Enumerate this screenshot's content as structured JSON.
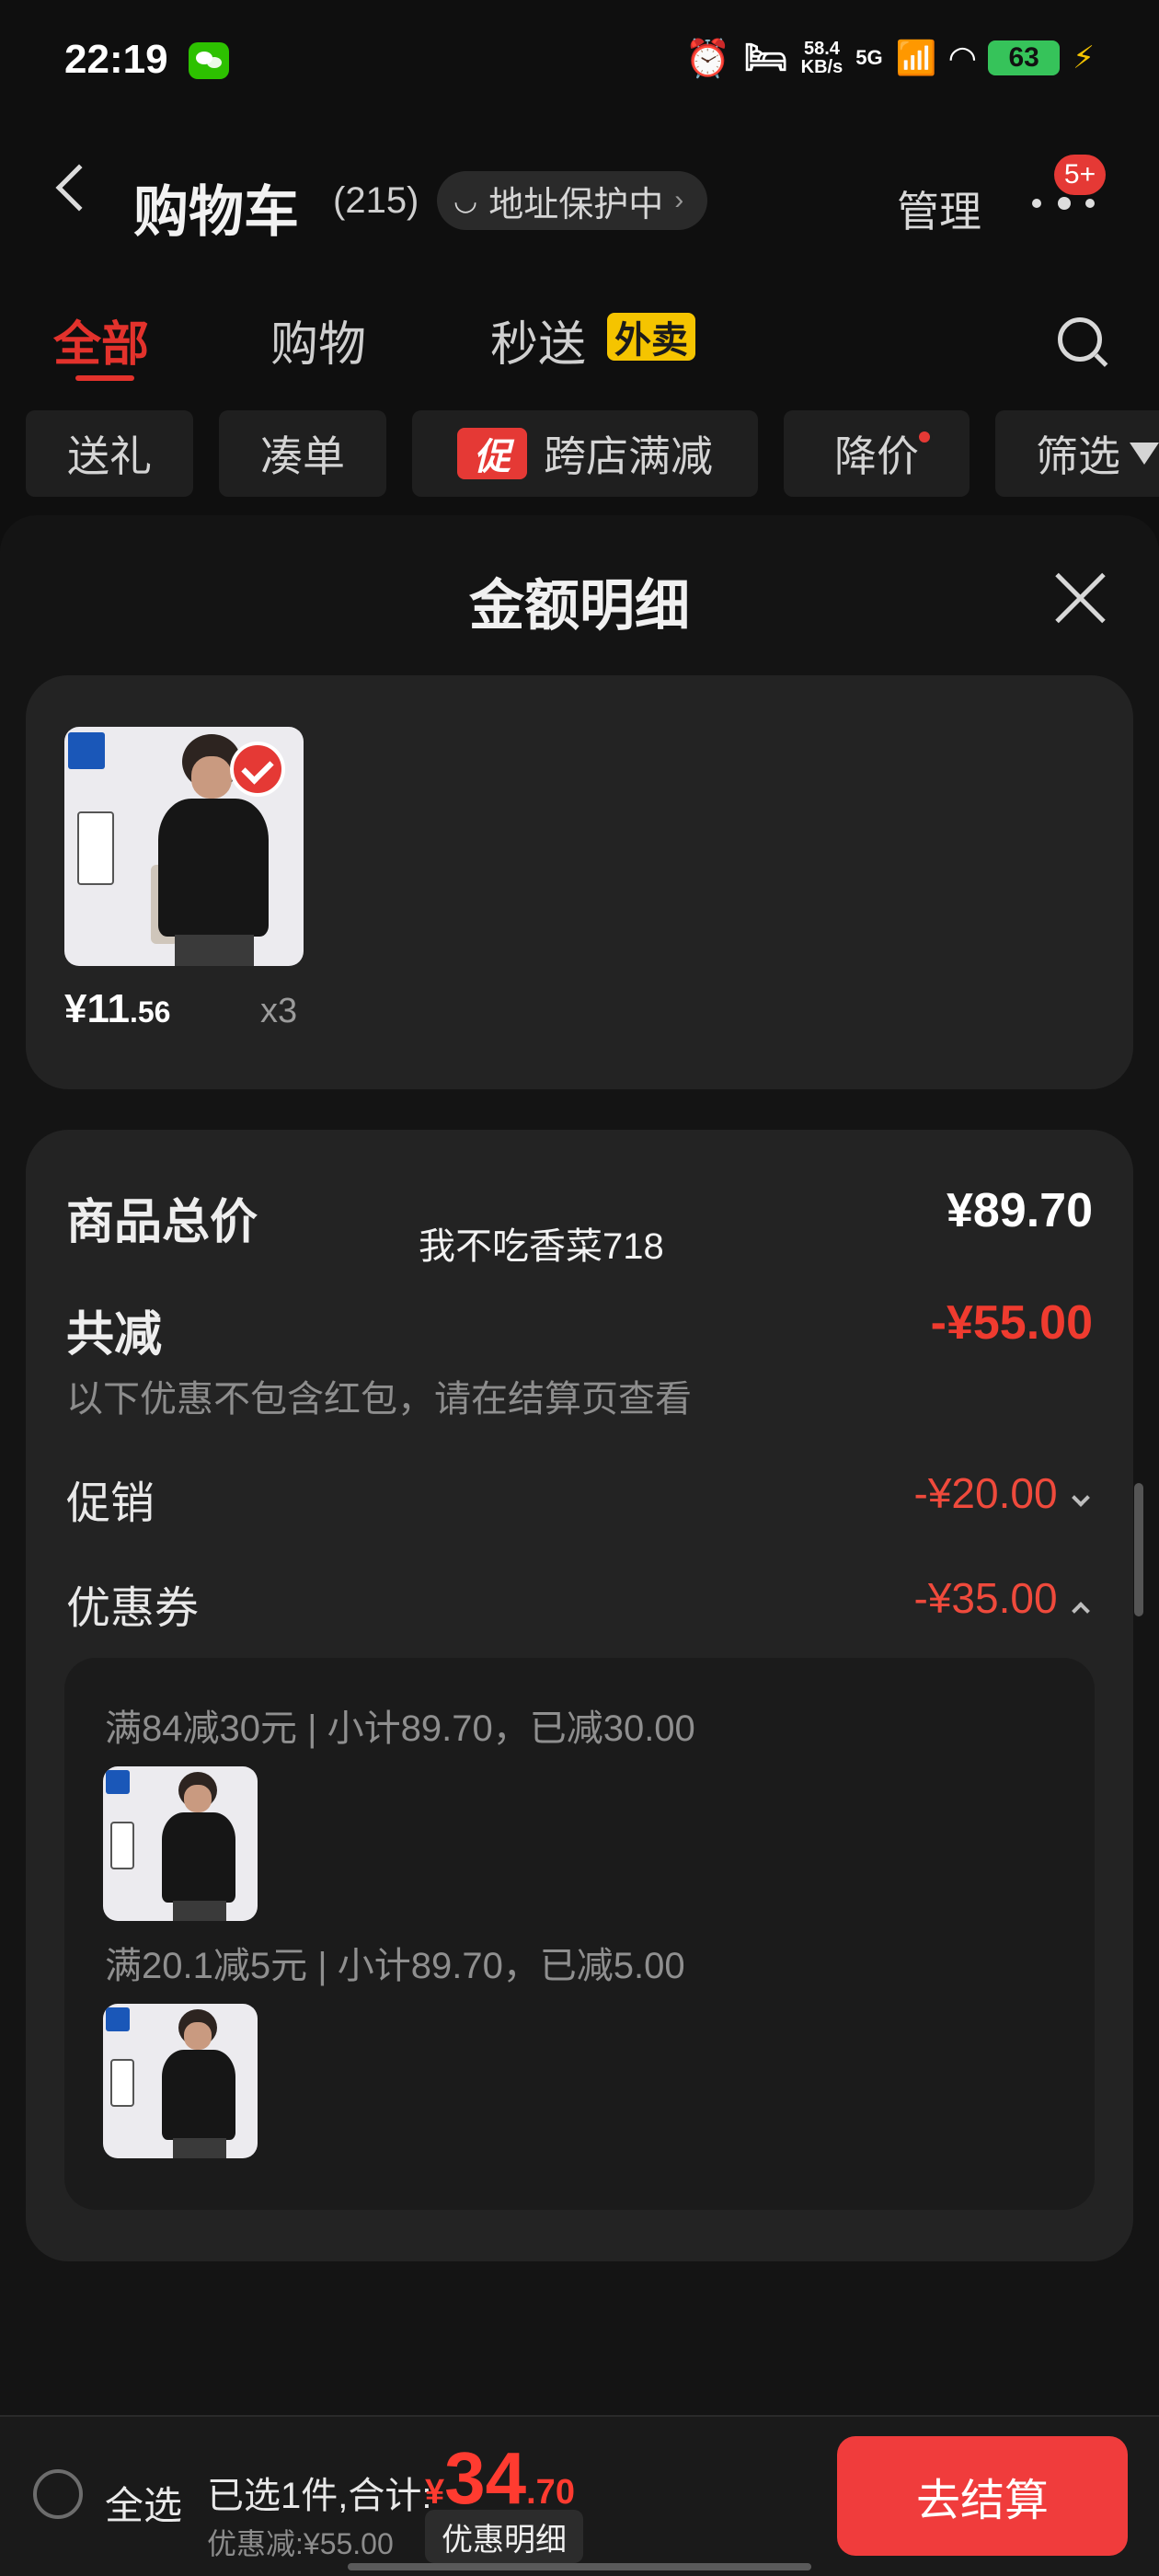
{
  "status_bar": {
    "time": "22:19",
    "net_speed_value": "58.4",
    "net_speed_unit": "KB/s",
    "network": "5G",
    "battery": "63"
  },
  "header": {
    "title": "购物车",
    "count": "(215)",
    "address_protect": "地址保护中",
    "manage": "管理",
    "badge": "5+"
  },
  "tabs": [
    "全部",
    "购物",
    "秒送"
  ],
  "tab_badge": "外卖",
  "filters": {
    "gift": "送礼",
    "bundle": "凑单",
    "promo_tag": "促",
    "cross_store": "跨店满减",
    "price_drop": "降价",
    "filter": "筛选"
  },
  "sheet": {
    "title": "金额明细",
    "item": {
      "price_int": "¥11",
      "price_dec": ".56",
      "qty": "x3"
    },
    "goods_total_label": "商品总价",
    "goods_total_value": "¥89.70",
    "watermark": "我不吃香菜718",
    "reduce_label": "共减",
    "reduce_value": "-¥55.00",
    "note": "以下优惠不包含红包，请在结算页查看",
    "promo_label": "促销",
    "promo_value": "-¥20.00",
    "coupon_label": "优惠券",
    "coupon_value": "-¥35.00",
    "coupon_lines": [
      "满84减30元 | 小计89.70，已减30.00",
      "满20.1减5元 | 小计89.70，已减5.00"
    ]
  },
  "bottom": {
    "select_all": "全选",
    "summary": "已选1件,合计:",
    "total_yen": "¥",
    "total_int": "34",
    "total_dec": ".70",
    "discount": "优惠减:¥55.00",
    "detail_button": "优惠明细",
    "checkout": "去结算"
  },
  "colors": {
    "accent": "#e3322c",
    "discount": "#ef4a3c",
    "checkout": "#f03c3c",
    "waimai": "#f5c400"
  }
}
